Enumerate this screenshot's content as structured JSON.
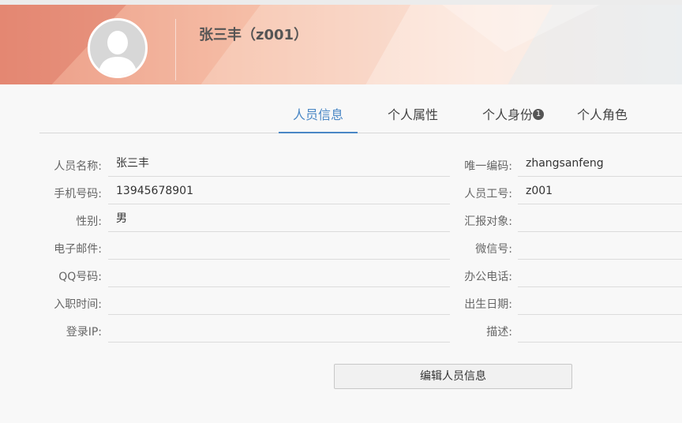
{
  "header": {
    "name_title": "张三丰（z001）"
  },
  "tabs": [
    {
      "label": "人员信息",
      "active": true
    },
    {
      "label": "个人属性",
      "active": false
    },
    {
      "label": "个人身份",
      "active": false,
      "badge": "1"
    },
    {
      "label": "个人角色",
      "active": false
    }
  ],
  "left_fields": [
    {
      "label": "人员名称:",
      "value": "张三丰"
    },
    {
      "label": "手机号码:",
      "value": "13945678901"
    },
    {
      "label": "性别:",
      "value": "男"
    },
    {
      "label": "电子邮件:",
      "value": ""
    },
    {
      "label": "QQ号码:",
      "value": ""
    },
    {
      "label": "入职时间:",
      "value": ""
    },
    {
      "label": "登录IP:",
      "value": ""
    }
  ],
  "right_fields": [
    {
      "label": "唯一编码:",
      "value": "zhangsanfeng"
    },
    {
      "label": "人员工号:",
      "value": "z001"
    },
    {
      "label": "汇报对象:",
      "value": ""
    },
    {
      "label": "微信号:",
      "value": ""
    },
    {
      "label": "办公电话:",
      "value": ""
    },
    {
      "label": "出生日期:",
      "value": ""
    },
    {
      "label": "描述:",
      "value": ""
    }
  ],
  "actions": {
    "edit_label": "编辑人员信息"
  },
  "colors": {
    "accent": "#4a87c5",
    "banner_warm": "#e8907a",
    "banner_light": "#fbe7dc"
  }
}
